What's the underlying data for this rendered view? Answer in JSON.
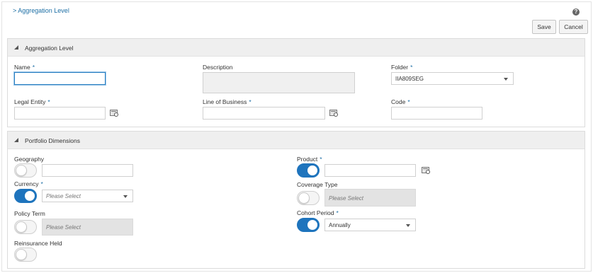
{
  "breadcrumb": "> Aggregation Level",
  "help_icon": "help-icon",
  "toolbar": {
    "save_label": "Save",
    "cancel_label": "Cancel"
  },
  "required_marker": "*",
  "aggregation_section": {
    "title": "Aggregation Level",
    "name": {
      "label": "Name",
      "required": true,
      "value": ""
    },
    "description": {
      "label": "Description",
      "value": ""
    },
    "folder": {
      "label": "Folder",
      "required": true,
      "value": "IIA809SEG"
    },
    "legal_entity": {
      "label": "Legal Entity",
      "required": true,
      "value": ""
    },
    "line_of_business": {
      "label": "Line of Business",
      "required": true,
      "value": ""
    },
    "code": {
      "label": "Code",
      "required": true,
      "value": ""
    }
  },
  "portfolio_section": {
    "title": "Portfolio Dimensions",
    "geography": {
      "label": "Geography",
      "enabled": false,
      "value": ""
    },
    "currency": {
      "label": "Currency",
      "required": true,
      "enabled": true,
      "placeholder": "Please Select"
    },
    "policy_term": {
      "label": "Policy Term",
      "enabled": false,
      "placeholder": "Please Select"
    },
    "reinsurance_held": {
      "label": "Reinsurance Held",
      "enabled": false
    },
    "product": {
      "label": "Product",
      "required": true,
      "enabled": true,
      "value": ""
    },
    "coverage_type": {
      "label": "Coverage Type",
      "enabled": false,
      "placeholder": "Please Select"
    },
    "cohort_period": {
      "label": "Cohort Period",
      "required": true,
      "enabled": true,
      "value": "Annually"
    }
  },
  "colors": {
    "accent": "#1e74bd",
    "link": "#1d6fa5",
    "header_bg": "#efefef",
    "disabled_bg": "#e3e3e3"
  }
}
